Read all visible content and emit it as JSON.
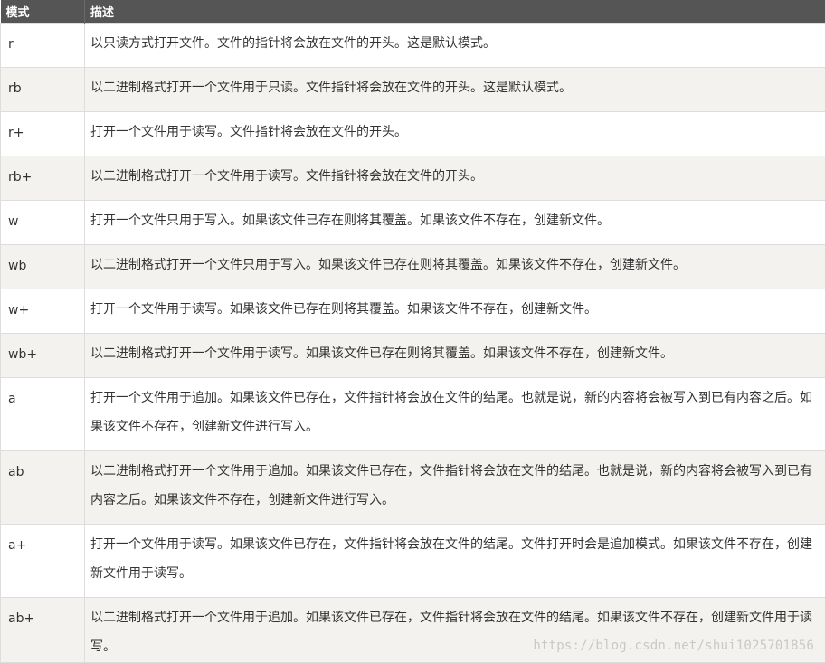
{
  "table": {
    "headers": {
      "mode": "模式",
      "description": "描述"
    },
    "rows": [
      {
        "mode": "r",
        "desc": "以只读方式打开文件。文件的指针将会放在文件的开头。这是默认模式。"
      },
      {
        "mode": "rb",
        "desc": "以二进制格式打开一个文件用于只读。文件指针将会放在文件的开头。这是默认模式。"
      },
      {
        "mode": "r+",
        "desc": "打开一个文件用于读写。文件指针将会放在文件的开头。"
      },
      {
        "mode": "rb+",
        "desc": "以二进制格式打开一个文件用于读写。文件指针将会放在文件的开头。"
      },
      {
        "mode": "w",
        "desc": "打开一个文件只用于写入。如果该文件已存在则将其覆盖。如果该文件不存在，创建新文件。"
      },
      {
        "mode": "wb",
        "desc": "以二进制格式打开一个文件只用于写入。如果该文件已存在则将其覆盖。如果该文件不存在，创建新文件。"
      },
      {
        "mode": "w+",
        "desc": "打开一个文件用于读写。如果该文件已存在则将其覆盖。如果该文件不存在，创建新文件。"
      },
      {
        "mode": "wb+",
        "desc": "以二进制格式打开一个文件用于读写。如果该文件已存在则将其覆盖。如果该文件不存在，创建新文件。"
      },
      {
        "mode": "a",
        "desc": "打开一个文件用于追加。如果该文件已存在，文件指针将会放在文件的结尾。也就是说，新的内容将会被写入到已有内容之后。如果该文件不存在，创建新文件进行写入。"
      },
      {
        "mode": "ab",
        "desc": "以二进制格式打开一个文件用于追加。如果该文件已存在，文件指针将会放在文件的结尾。也就是说，新的内容将会被写入到已有内容之后。如果该文件不存在，创建新文件进行写入。"
      },
      {
        "mode": "a+",
        "desc": "打开一个文件用于读写。如果该文件已存在，文件指针将会放在文件的结尾。文件打开时会是追加模式。如果该文件不存在，创建新文件用于读写。"
      },
      {
        "mode": "ab+",
        "desc": "以二进制格式打开一个文件用于追加。如果该文件已存在，文件指针将会放在文件的结尾。如果该文件不存在，创建新文件用于读写。"
      }
    ]
  },
  "watermark": "https://blog.csdn.net/shui1025701856"
}
